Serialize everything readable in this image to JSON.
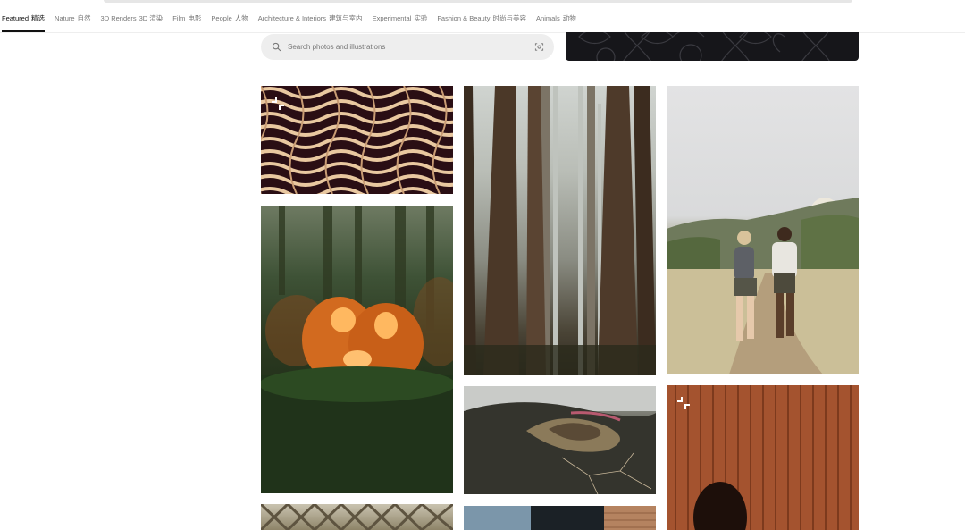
{
  "topics": [
    {
      "en": "Featured",
      "zh": "精选",
      "active": true
    },
    {
      "en": "Nature",
      "zh": "自然",
      "active": false
    },
    {
      "en": "3D Renders",
      "zh": "3D 渲染",
      "active": false
    },
    {
      "en": "Film",
      "zh": "电影",
      "active": false
    },
    {
      "en": "People",
      "zh": "人物",
      "active": false
    },
    {
      "en": "Architecture & Interiors",
      "zh": "建筑与室内",
      "active": false
    },
    {
      "en": "Experimental",
      "zh": "实验",
      "active": false
    },
    {
      "en": "Fashion & Beauty",
      "zh": "时尚与美容",
      "active": false
    },
    {
      "en": "Animals",
      "zh": "动物",
      "active": false
    }
  ],
  "search": {
    "placeholder": "Search photos and illustrations",
    "value": "",
    "leading_icon": "search-icon",
    "trailing_icon": "visual-search-icon"
  },
  "colors": {
    "active_underline": "#111111",
    "inactive_text": "#767676",
    "search_bg": "#eeeeee",
    "banner_bg": "#16161a"
  },
  "photos": [
    {
      "id": "pattern",
      "subject": "abstract wave pattern",
      "plus_badge": true
    },
    {
      "id": "pumpkin",
      "subject": "carved pumpkin in forest",
      "plus_badge": false
    },
    {
      "id": "forest",
      "subject": "misty redwood forest",
      "plus_badge": false
    },
    {
      "id": "hikers",
      "subject": "two hikers on trail",
      "plus_badge": false
    },
    {
      "id": "aerial",
      "subject": "aerial volcanic landscape",
      "plus_badge": false
    },
    {
      "id": "wood",
      "subject": "wooden wall with shadow",
      "plus_badge": true
    },
    {
      "id": "architecture",
      "subject": "architectural ceiling",
      "plus_badge": false
    },
    {
      "id": "water",
      "subject": "water and dock",
      "plus_badge": false
    }
  ]
}
